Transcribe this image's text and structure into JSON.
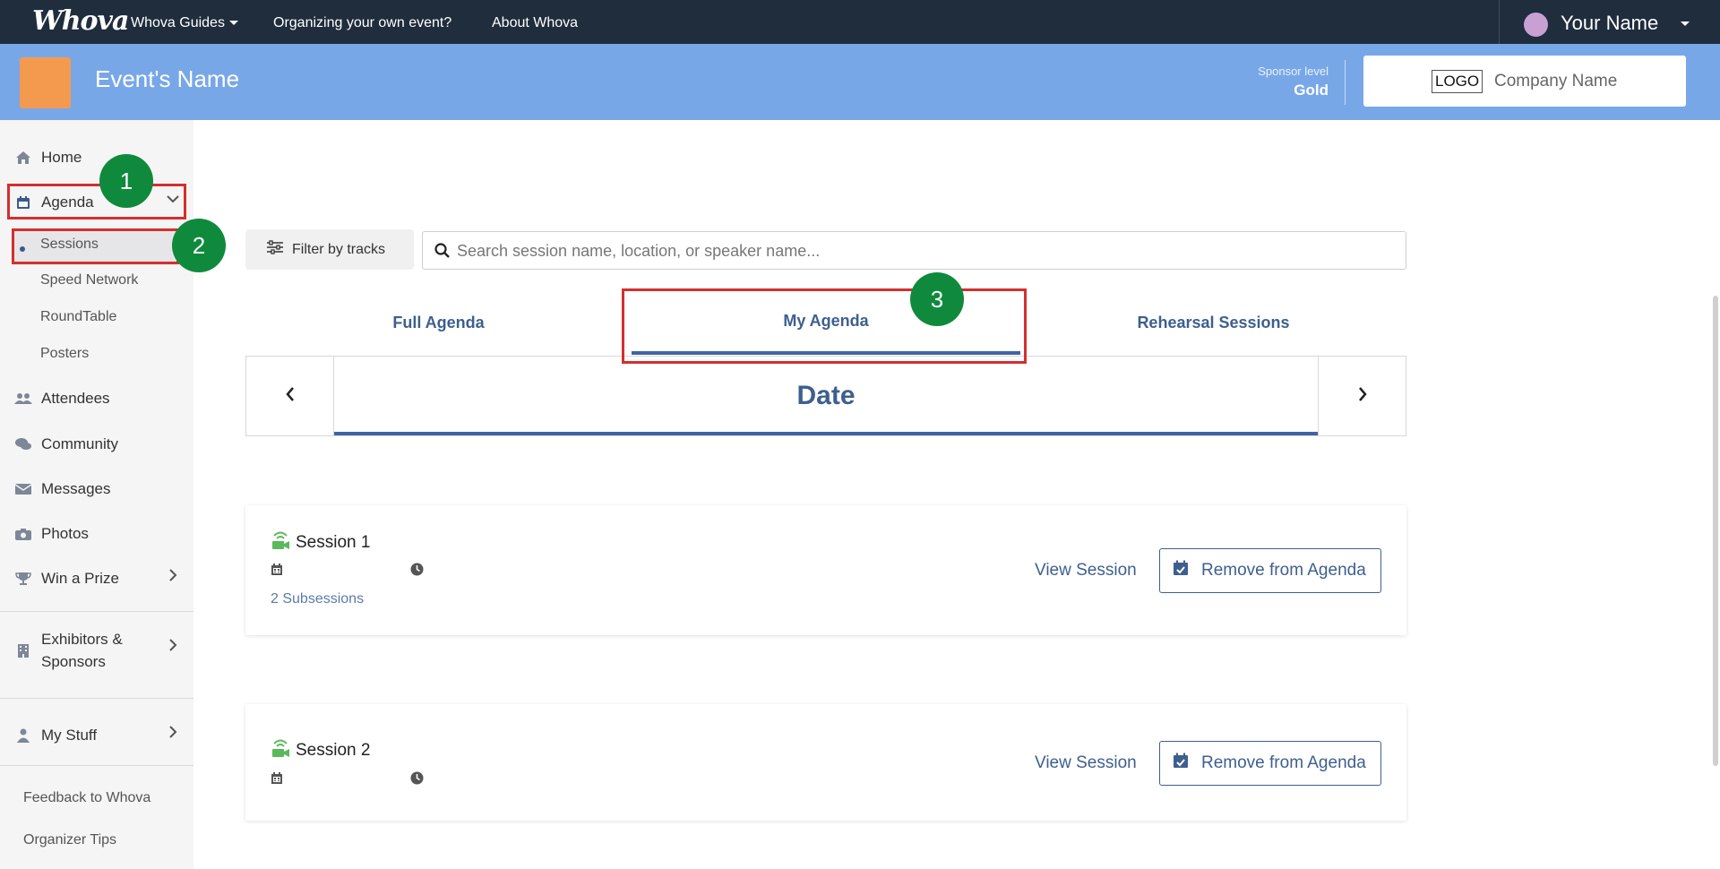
{
  "topnav": {
    "logo": "Whova",
    "links": [
      "Whova Guides",
      "Organizing your own event?",
      "About Whova"
    ],
    "user_name": "Your Name"
  },
  "event": {
    "name": "Event's Name",
    "sponsor_level_label": "Sponsor level",
    "sponsor_level_value": "Gold",
    "company_logo": "LOGO",
    "company_name": "Company Name"
  },
  "sidebar": {
    "items": [
      {
        "label": "Home",
        "icon": "home-icon"
      },
      {
        "label": "Agenda",
        "icon": "calendar-icon"
      },
      {
        "label": "Attendees",
        "icon": "users-icon"
      },
      {
        "label": "Community",
        "icon": "comments-icon"
      },
      {
        "label": "Messages",
        "icon": "envelope-icon"
      },
      {
        "label": "Photos",
        "icon": "camera-icon"
      },
      {
        "label": "Win a Prize",
        "icon": "trophy-icon"
      },
      {
        "label": "Exhibitors &",
        "label2": "Sponsors",
        "icon": "building-icon"
      },
      {
        "label": "My Stuff",
        "icon": "user-icon"
      }
    ],
    "agenda_sub": [
      "Sessions",
      "Speed Network",
      "RoundTable",
      "Posters"
    ],
    "footer": [
      "Feedback to Whova",
      "Organizer Tips"
    ]
  },
  "annotations": [
    "1",
    "2",
    "3"
  ],
  "toolbar": {
    "filter_label": "Filter by tracks",
    "search_placeholder": "Search session name, location, or speaker name..."
  },
  "tabs": [
    "Full Agenda",
    "My Agenda",
    "Rehearsal Sessions"
  ],
  "date_nav": {
    "label": "Date",
    "prev": "‹",
    "next": "›"
  },
  "sessions": [
    {
      "title": "Session 1",
      "subsessions": "2 Subsessions",
      "view": "View Session",
      "remove": "Remove from Agenda"
    },
    {
      "title": "Session 2",
      "view": "View Session",
      "remove": "Remove from Agenda"
    }
  ],
  "colors": {
    "topnav": "#1f2d3d",
    "event_bar": "#78a7e8",
    "accent": "#3e5f8e",
    "annotation_red": "#d32f2f",
    "annotation_green": "#0f8a3c"
  }
}
